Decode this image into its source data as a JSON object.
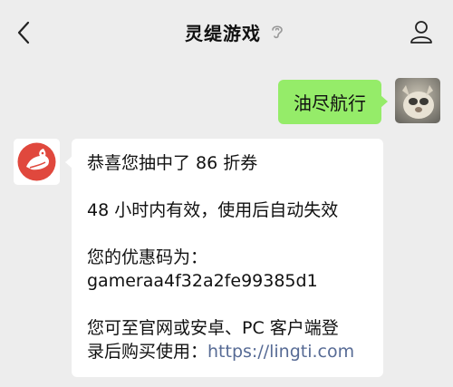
{
  "header": {
    "title": "灵缇游戏",
    "back_icon": "chevron-left-icon",
    "status_icon": "ear-icon",
    "profile_icon": "person-icon"
  },
  "colors": {
    "background": "#ededed",
    "outgoing_bubble": "#95ec69",
    "incoming_bubble": "#ffffff",
    "link": "#576b95",
    "bot_avatar_red": "#e0483d"
  },
  "messages": {
    "outgoing": {
      "text": "油尽航行",
      "avatar": "user-avatar-photo"
    },
    "incoming": {
      "avatar": "lingti-logo-icon",
      "line1": "恭喜您抽中了 86 折券",
      "line2": "48 小时内有效，使用后自动失效",
      "line3": "您的优惠码为：",
      "line4": "gameraa4f32a2fe99385d1",
      "line5": "您可至官网或安卓、PC 客户端登",
      "line6_prefix": "录后购买使用：",
      "link": "https://lingti.com"
    }
  }
}
